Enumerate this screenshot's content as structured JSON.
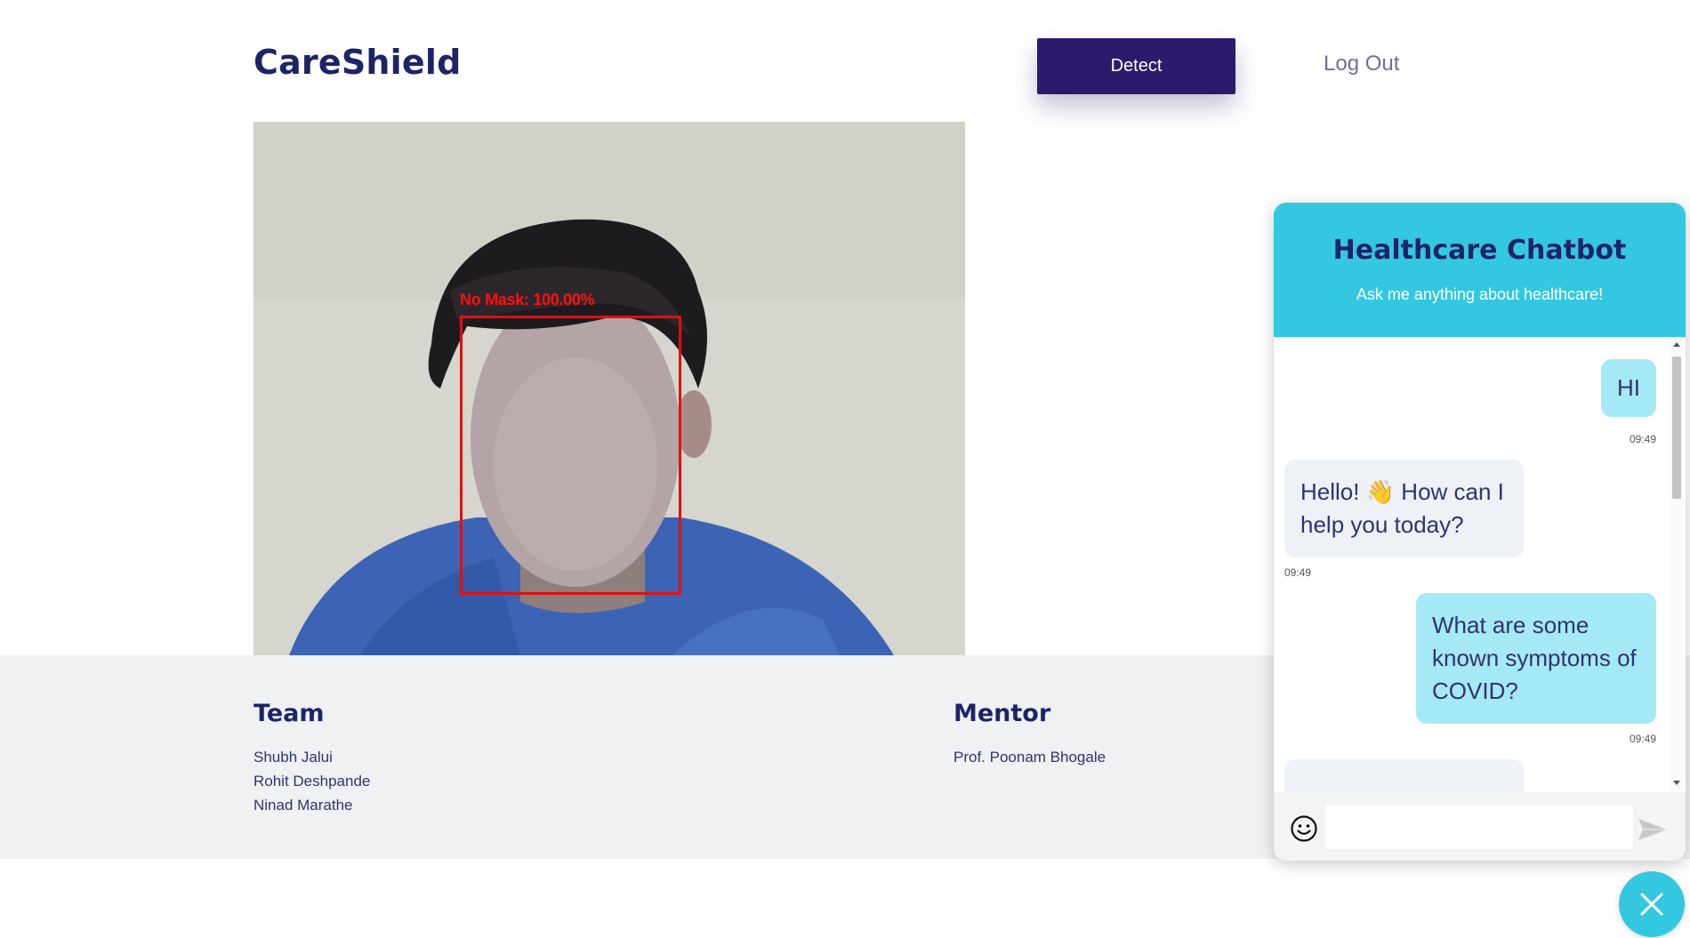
{
  "header": {
    "logo": "CareShield",
    "detect_label": "Detect",
    "logout_label": "Log Out"
  },
  "camera": {
    "detection_label": "No Mask: 100.00%"
  },
  "footer": {
    "team_heading": "Team",
    "team_members": [
      "Shubh Jalui",
      "Rohit Deshpande",
      "Ninad Marathe"
    ],
    "mentor_heading": "Mentor",
    "mentor_name": "Prof. Poonam Bhogale"
  },
  "chat": {
    "title": "Healthcare Chatbot",
    "subtitle": "Ask me anything about healthcare!",
    "messages": [
      {
        "from": "user",
        "text": "HI",
        "time": "09:49"
      },
      {
        "from": "bot",
        "text": "Hello! 👋 How can I help you today?",
        "time": "09:49"
      },
      {
        "from": "user",
        "text": "What are some known symptoms of COVID?",
        "time": "09:49"
      }
    ],
    "input_value": "",
    "input_placeholder": ""
  },
  "colors": {
    "brand_navy": "#1d2466",
    "detect_button": "#2d1a6b",
    "chat_accent": "#33c8e0",
    "user_bubble": "#a6e9f6",
    "bot_bubble": "#eef1f6",
    "detection_red": "#e01010",
    "footer_bg": "#f0f1f3"
  },
  "icons": {
    "emoji": "smiley-icon",
    "send": "send-icon",
    "close": "close-icon"
  }
}
